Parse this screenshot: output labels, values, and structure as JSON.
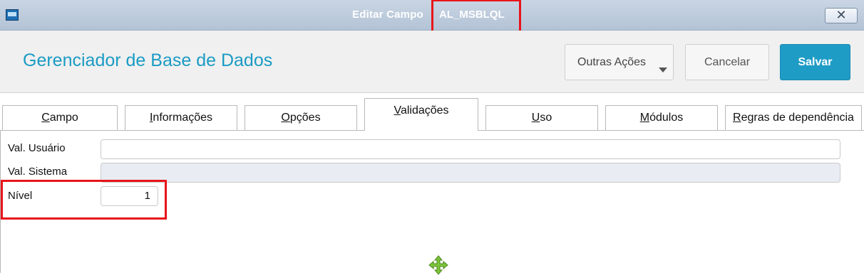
{
  "window": {
    "title": "Editar Campo",
    "field_name": "AL_MSBLQL",
    "close_symbol": "✕"
  },
  "header": {
    "app_title": "Gerenciador de Base de Dados",
    "actions": {
      "other_label": "Outras Ações",
      "cancel_label": "Cancelar",
      "save_label": "Salvar"
    }
  },
  "tabs": [
    {
      "label": "Campo",
      "access_key": "C",
      "rest": "ampo",
      "active": false
    },
    {
      "label": "Informações",
      "access_key": "I",
      "rest": "nformações",
      "active": false
    },
    {
      "label": "Opções",
      "access_key": "O",
      "rest": "pções",
      "active": false
    },
    {
      "label": "Validações",
      "access_key": "V",
      "rest": "alidações",
      "active": true
    },
    {
      "label": "Uso",
      "access_key": "U",
      "rest": "so",
      "active": false
    },
    {
      "label": "Módulos",
      "access_key": "M",
      "rest": "ódulos",
      "active": false
    },
    {
      "label": "Regras de dependência",
      "access_key": "R",
      "rest": "egras de dependência",
      "active": false
    }
  ],
  "form": {
    "val_usuario": {
      "label": "Val. Usuário",
      "value": ""
    },
    "val_sistema": {
      "label": "Val. Sistema",
      "value": ""
    },
    "nivel": {
      "label": "Nível",
      "value": "1"
    }
  },
  "colors": {
    "accent": "#1b9bc4",
    "save_button": "#1f9cc6",
    "highlight": "#e8141b",
    "move_icon": "#7cc43a"
  },
  "icons": {
    "window": "app-window-icon",
    "close": "close-icon",
    "dropdown": "chevron-down-icon",
    "move": "move-cursor-icon"
  }
}
